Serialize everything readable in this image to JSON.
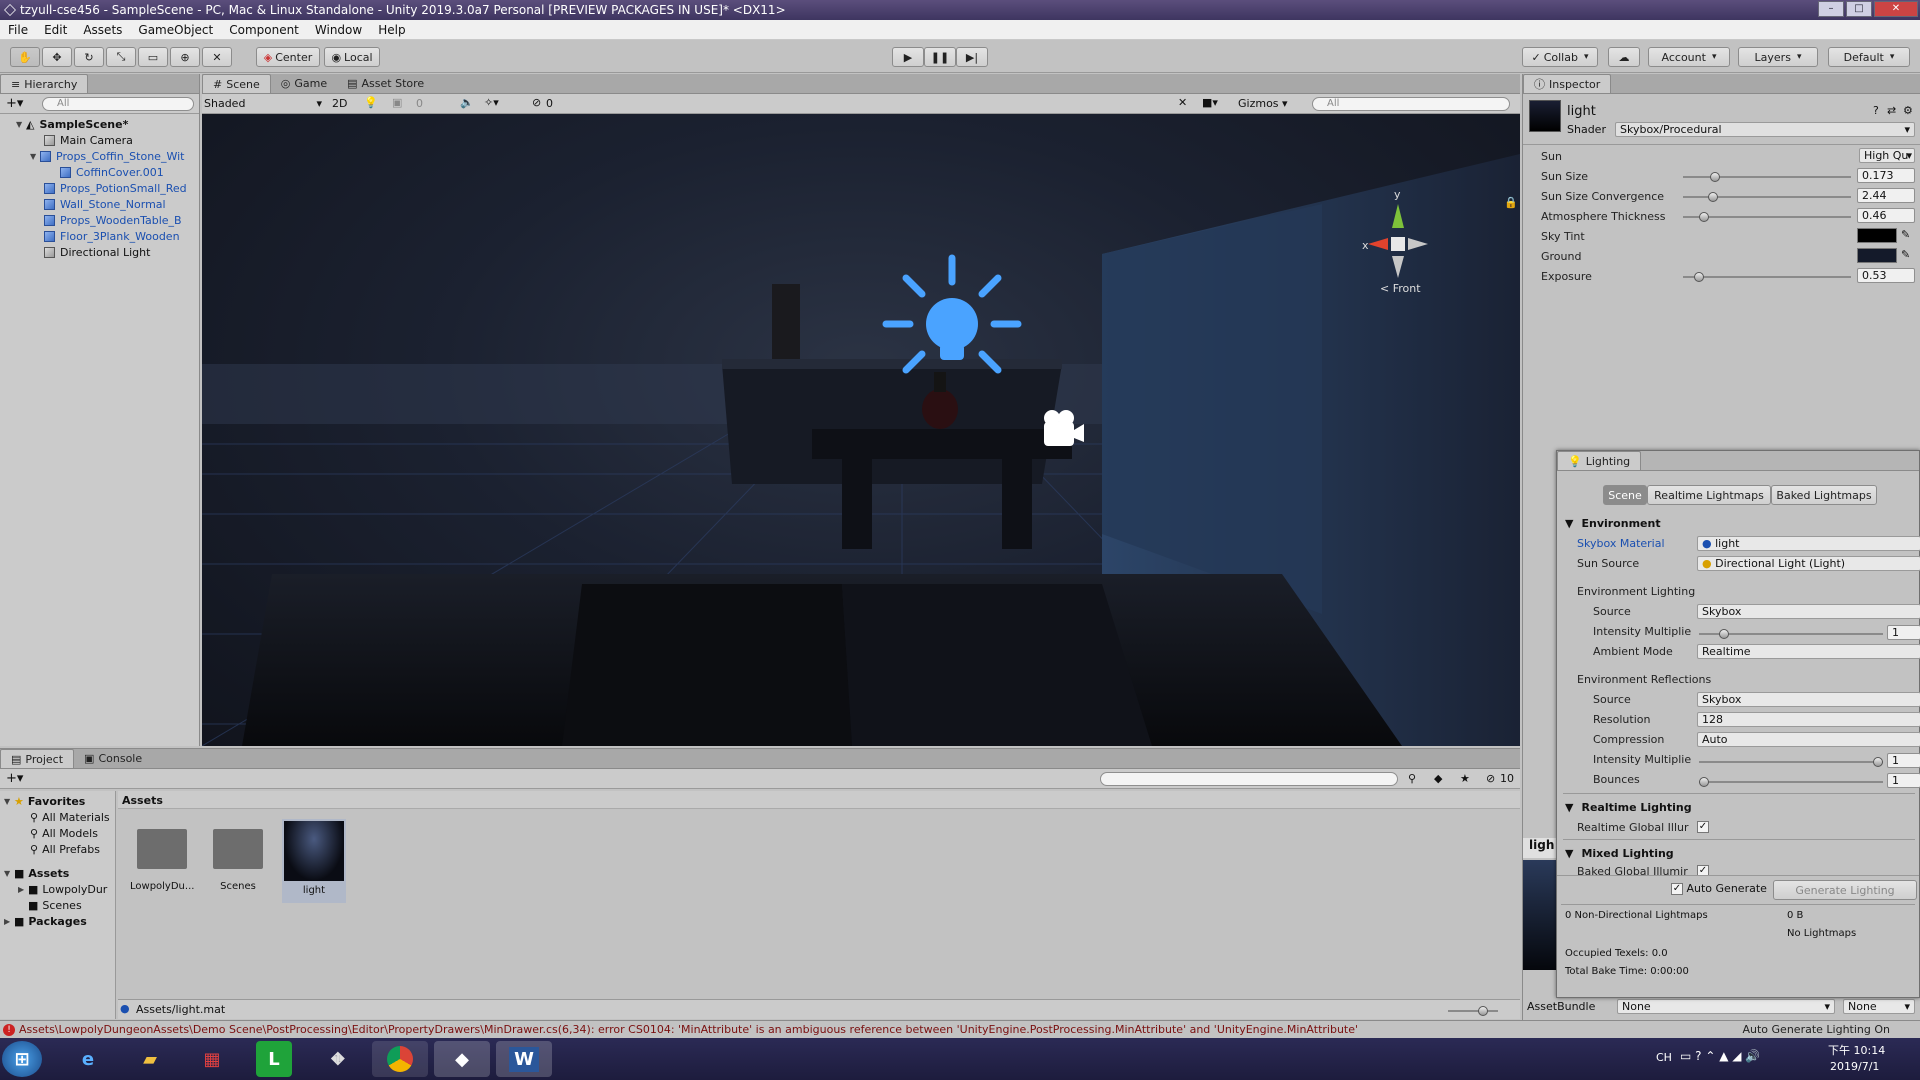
{
  "window": {
    "title": "tzyull-cse456 - SampleScene - PC, Mac & Linux Standalone - Unity 2019.3.0a7 Personal [PREVIEW PACKAGES IN USE]* <DX11>",
    "controls": [
      "–",
      "□",
      "✕"
    ]
  },
  "menu": [
    "File",
    "Edit",
    "Assets",
    "GameObject",
    "Component",
    "Window",
    "Help"
  ],
  "toolbar": {
    "pivot": "Center",
    "space": "Local",
    "collab": "Collab",
    "account": "Account",
    "layers": "Layers",
    "layout": "Default"
  },
  "hierarchy": {
    "tab": "Hierarchy",
    "search_placeholder": "All",
    "scene": "SampleScene*",
    "items": [
      {
        "label": "Main Camera",
        "prefab": false
      },
      {
        "label": "Props_Coffin_Stone_Wit",
        "prefab": true
      },
      {
        "label": "CoffinCover.001",
        "prefab": true
      },
      {
        "label": "Props_PotionSmall_Red",
        "prefab": true
      },
      {
        "label": "Wall_Stone_Normal",
        "prefab": true
      },
      {
        "label": "Props_WoodenTable_B",
        "prefab": true
      },
      {
        "label": "Floor_3Plank_Wooden",
        "prefab": true
      },
      {
        "label": "Directional Light",
        "prefab": false
      }
    ]
  },
  "scene": {
    "tabs": [
      "Scene",
      "Game",
      "Asset Store"
    ],
    "shading": "Shaded",
    "mode_2d": "2D",
    "fx_count": "0",
    "hidden_count": "0",
    "gizmos": "Gizmos",
    "search_placeholder": "All",
    "gizmo_y": "y",
    "gizmo_x": "x",
    "view_label": "< Front"
  },
  "inspector": {
    "tab": "Inspector",
    "material_name": "light",
    "shader_label": "Shader",
    "shader_value": "Skybox/Procedural",
    "sun_label": "Sun",
    "sun_value": "High Qu",
    "props": [
      {
        "label": "Sun Size",
        "value": "0.173",
        "fraction": 0.17
      },
      {
        "label": "Sun Size Convergence",
        "value": "2.44",
        "fraction": 0.16
      },
      {
        "label": "Atmosphere Thickness",
        "value": "0.46",
        "fraction": 0.1
      },
      {
        "label": "Sky Tint",
        "color": "#000000"
      },
      {
        "label": "Ground",
        "color": "#141a2a"
      },
      {
        "label": "Exposure",
        "value": "0.53",
        "fraction": 0.07
      }
    ],
    "preview_label": "ligh",
    "assetbundle_label": "AssetBundle",
    "assetbundle_value": "None",
    "assetbundle_variant": "None"
  },
  "lighting": {
    "title": "Lighting",
    "tabs": [
      "Scene",
      "Realtime Lightmaps",
      "Baked Lightmaps"
    ],
    "environment_header": "Environment",
    "skybox_material_label": "Skybox Material",
    "skybox_material_value": "light",
    "sun_source_label": "Sun Source",
    "sun_source_value": "Directional Light (Light)",
    "env_lighting_label": "Environment Lighting",
    "source_label": "Source",
    "env_source_value": "Skybox",
    "intensity_label": "Intensity Multiplie",
    "env_intensity_value": "1",
    "ambient_mode_label": "Ambient Mode",
    "ambient_mode_value": "Realtime",
    "env_reflections_label": "Environment Reflections",
    "refl_source_value": "Skybox",
    "resolution_label": "Resolution",
    "resolution_value": "128",
    "compression_label": "Compression",
    "compression_value": "Auto",
    "refl_intensity_value": "1",
    "bounces_label": "Bounces",
    "bounces_value": "1",
    "realtime_header": "Realtime Lighting",
    "realtime_gi_label": "Realtime Global Illur",
    "mixed_header": "Mixed Lighting",
    "baked_gi_label": "Baked Global Illumir",
    "auto_generate_label": "Auto Generate",
    "generate_button": "Generate Lighting",
    "stats_lightmaps_label": "0 Non-Directional Lightmaps",
    "stats_lightmaps_value": "0 B",
    "stats_no_lightmaps": "No Lightmaps",
    "stats_texels": "Occupied Texels: 0.0",
    "stats_bake_time": "Total Bake Time: 0:00:00"
  },
  "project": {
    "tabs": [
      "Project",
      "Console"
    ],
    "hidden_count": "10",
    "favorites_label": "Favorites",
    "favorites": [
      "All Materials",
      "All Models",
      "All Prefabs"
    ],
    "assets_label": "Assets",
    "asset_folders": [
      "LowpolyDur",
      "Scenes"
    ],
    "packages_label": "Packages",
    "breadcrumb": "Assets",
    "grid_items": [
      {
        "label": "LowpolyDu...",
        "kind": "folder"
      },
      {
        "label": "Scenes",
        "kind": "folder"
      },
      {
        "label": "light",
        "kind": "material"
      }
    ],
    "selected_path": "Assets/light.mat"
  },
  "status": {
    "error": "Assets\\LowpolyDungeonAssets\\Demo Scene\\PostProcessing\\Editor\\PropertyDrawers\\MinDrawer.cs(6,34): error CS0104: 'MinAttribute' is an ambiguous reference between 'UnityEngine.PostProcessing.MinAttribute' and 'UnityEngine.MinAttribute'",
    "right": "Auto Generate Lighting On"
  },
  "taskbar": {
    "apps": [
      "start-icon",
      "ie-icon",
      "explorer-icon",
      "apps-icon",
      "line-icon",
      "unknown-app-icon",
      "chrome-icon",
      "unity-icon",
      "word-icon"
    ],
    "lang": "CH",
    "time": "下午 10:14",
    "date": "2019/7/1"
  },
  "colors": {
    "error": "#8a1010",
    "link_blue": "#1a4fb0",
    "light_icon": "#4aa3ff"
  }
}
